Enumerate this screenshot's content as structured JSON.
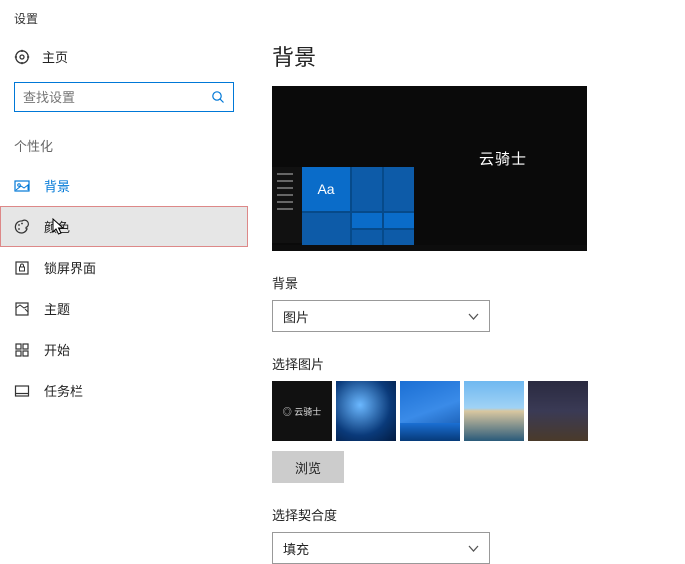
{
  "app_title": "设置",
  "home_label": "主页",
  "search": {
    "placeholder": "查找设置"
  },
  "category_label": "个性化",
  "nav": [
    {
      "label": "背景"
    },
    {
      "label": "颜色"
    },
    {
      "label": "锁屏界面"
    },
    {
      "label": "主题"
    },
    {
      "label": "开始"
    },
    {
      "label": "任务栏"
    }
  ],
  "page_title": "背景",
  "preview": {
    "sample_text": "云骑士",
    "tile_label": "Aa"
  },
  "background_section": {
    "label": "背景",
    "dropdown_value": "图片"
  },
  "choose_pic": {
    "label": "选择图片",
    "browse_label": "浏览",
    "thumb1_text": "◎ 云骑士"
  },
  "fit_section": {
    "label": "选择契合度",
    "dropdown_value": "填充"
  }
}
